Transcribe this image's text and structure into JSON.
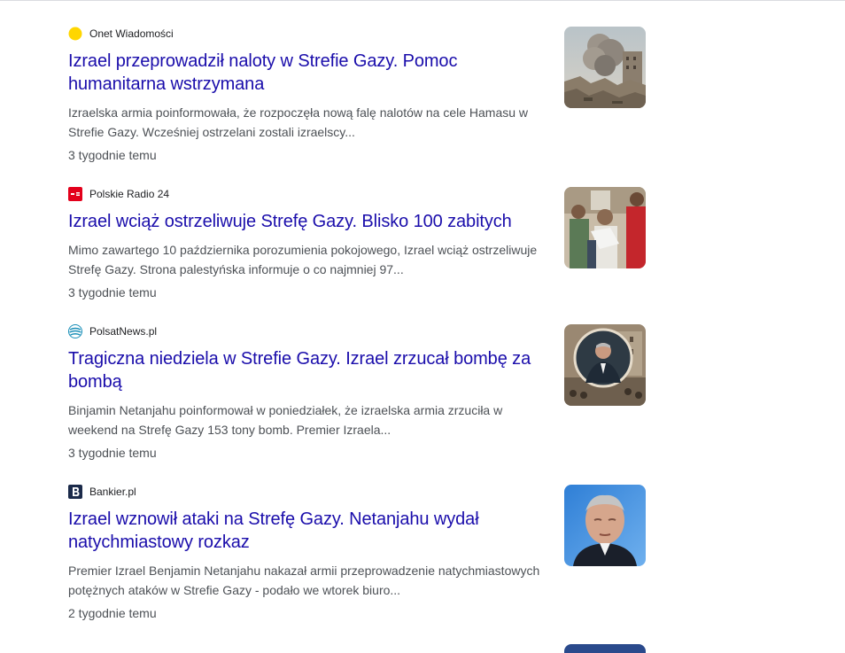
{
  "results": [
    {
      "source": "Onet Wiadomości",
      "favicon": "onet-dot-icon",
      "title": "Izrael przeprowadził naloty w Strefie Gazy. Pomoc humanitarna wstrzymana",
      "snippet": "Izraelska armia poinformowała, że rozpoczęła nową falę nalotów na cele Hamasu w Strefie Gazy. Wcześniej ostrzelani zostali izraelscy...",
      "time": "3 tygodnie temu",
      "thumbnail": "airstrike-smoke-photo"
    },
    {
      "source": "Polskie Radio 24",
      "favicon": "polskie-radio-icon",
      "title": "Izrael wciąż ostrzeliwuje Strefę Gazy. Blisko 100 zabitych",
      "snippet": "Mimo zawartego 10 października porozumienia pokojowego, Izrael wciąż ostrzeliwuje Strefę Gazy. Strona palestyńska informuje o co najmniej 97...",
      "time": "3 tygodnie temu",
      "thumbnail": "crowd-people-photo"
    },
    {
      "source": "PolsatNews.pl",
      "favicon": "polsat-globe-icon",
      "title": "Tragiczna niedziela w Strefie Gazy. Izrael zrzucał bombę za bombą",
      "snippet": "Binjamin Netanjahu poinformował w poniedziałek, że izraelska armia zrzuciła w weekend na Strefę Gazy 153 tony bomb. Premier Izraela...",
      "time": "3 tygodnie temu",
      "thumbnail": "netanyahu-inset-photo"
    },
    {
      "source": "Bankier.pl",
      "favicon": "bankier-b-icon",
      "title": "Izrael wznowił ataki na Strefę Gazy. Netanjahu wydał natychmiastowy rozkaz",
      "snippet": "Premier Izrael Benjamin Netanjahu nakazał armii przeprowadzenie natychmiastowych potężnych ataków w Strefie Gazy - podało we wtorek biuro...",
      "time": "2 tygodnie temu",
      "thumbnail": "netanyahu-portrait-photo"
    }
  ],
  "colors": {
    "title_link": "#1a0dab",
    "snippet": "#4d5156",
    "source": "#202124",
    "onet_yellow": "#ffd600",
    "polskie_radio_red": "#e3001b",
    "bankier_navy": "#1b2a4a"
  }
}
